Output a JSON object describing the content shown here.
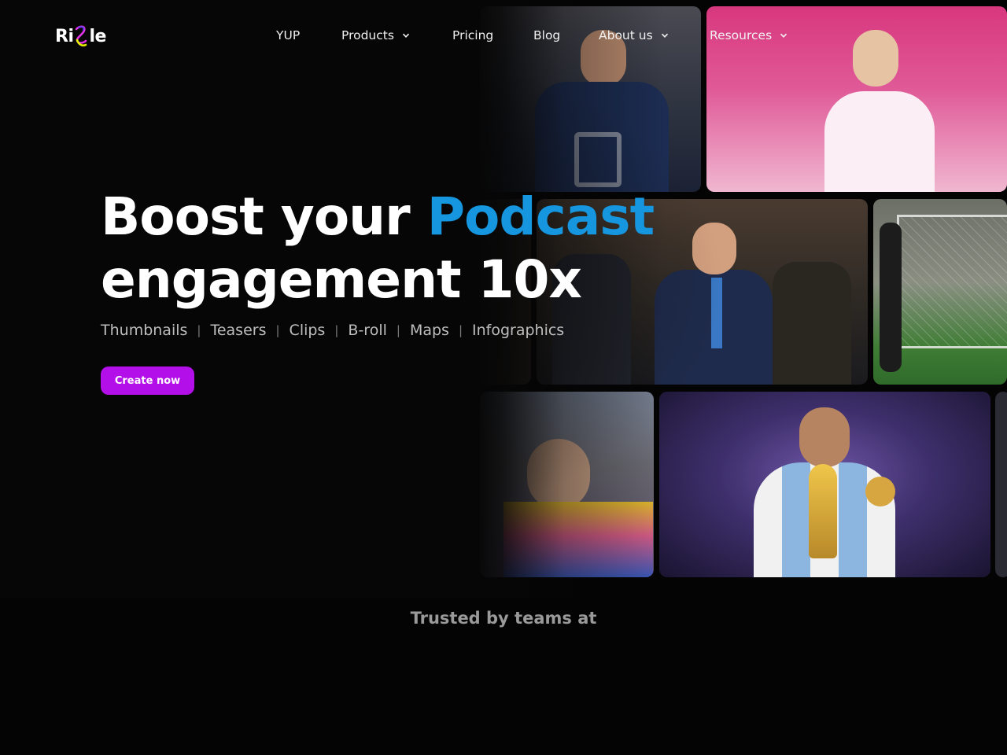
{
  "brand": {
    "logo_left": "Ri",
    "logo_right": "le",
    "logo_colors": [
      "#e233e9",
      "#6b3cf5",
      "#e4f000"
    ]
  },
  "nav": {
    "items": [
      {
        "label": "YUP",
        "dropdown": false
      },
      {
        "label": "Products",
        "dropdown": true
      },
      {
        "label": "Pricing",
        "dropdown": false
      },
      {
        "label": "Blog",
        "dropdown": false
      },
      {
        "label": "About us",
        "dropdown": true
      },
      {
        "label": "Resources",
        "dropdown": true
      }
    ]
  },
  "hero": {
    "title_part1": "Boost your ",
    "title_accent": "Podcast",
    "title_line2": "engagement 10x",
    "features": [
      "Thumbnails",
      "Teasers",
      "Clips",
      "B-roll",
      "Maps",
      "Infographics"
    ],
    "separator": "|",
    "cta_label": "Create now"
  },
  "trusted": {
    "label": "Trusted by teams at"
  },
  "colors": {
    "background": "#040404",
    "accent_blue": "#1596df",
    "cta_purple": "#b30fe8"
  }
}
